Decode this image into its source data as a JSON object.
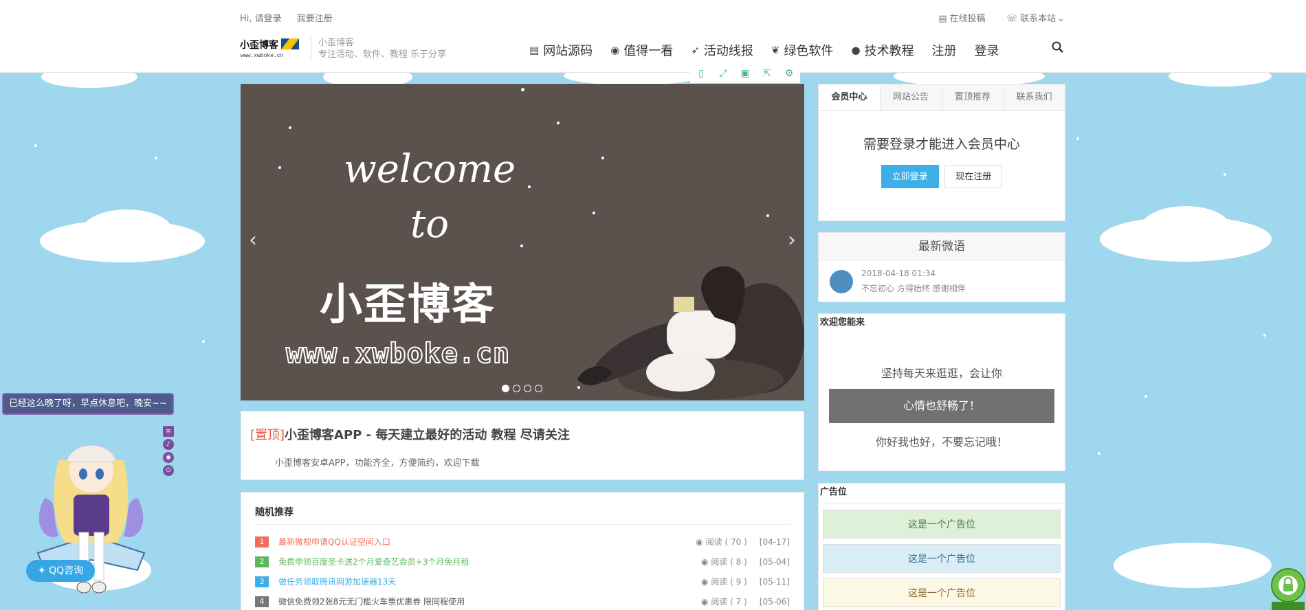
{
  "topbar": {
    "greeting": "Hi, 请登录",
    "register_link": "我要注册",
    "submit_link": "在线投稿",
    "contact_link": "联系本站",
    "logo_alt": "小歪博客",
    "site_name": "小歪博客",
    "site_tagline": "专注活动、软件、教程 乐于分享"
  },
  "nav": {
    "items": [
      {
        "icon": "list-icon",
        "label": "网站源码"
      },
      {
        "icon": "eye-icon",
        "label": "值得一看"
      },
      {
        "icon": "rocket-icon",
        "label": "活动线报"
      },
      {
        "icon": "leaf-icon",
        "label": "绿色软件"
      },
      {
        "icon": "chat-icon",
        "label": "技术教程"
      },
      {
        "icon": "",
        "label": "注册"
      },
      {
        "icon": "",
        "label": "登录"
      }
    ],
    "search_icon": "search-icon"
  },
  "slider": {
    "welcome_line1": "welcome",
    "welcome_line2": "to",
    "title": "小歪博客",
    "url": "www.xwboke.cn",
    "slide_count": 4,
    "active_slide": 1
  },
  "pinned": {
    "tag": "[置顶]",
    "title": "小歪博客APP - 每天建立最好的活动 教程 尽请关注",
    "desc": "小歪博客安卓APP，功能齐全，方便简约，欢迎下载"
  },
  "random": {
    "heading": "随机推荐",
    "rows": [
      {
        "num": "1",
        "title": "最新微视申请QQ认证空间入口",
        "reads": "阅读 ( 70 )",
        "date": "[04-17]",
        "color": "#f26b5b"
      },
      {
        "num": "2",
        "title": "免费申领百度圣卡送2个月爱奇艺会员+3个月免月租",
        "reads": "阅读 ( 8 )",
        "date": "[05-04]",
        "color": "#5cb85c"
      },
      {
        "num": "3",
        "title": "做任务领取腾讯网游加速器13天",
        "reads": "阅读 ( 9 )",
        "date": "[05-11]",
        "color": "#3eaee7"
      },
      {
        "num": "4",
        "title": "微信免费领2张8元无门槛火车票优惠券 限同程使用",
        "reads": "阅读 ( 7 )",
        "date": "[05-06]",
        "color": "#777777"
      }
    ]
  },
  "member": {
    "tabs": [
      "会员中心",
      "网站公告",
      "置顶推荐",
      "联系我们"
    ],
    "message": "需要登录才能进入会员中心",
    "login_btn": "立即登录",
    "register_btn": "现在注册"
  },
  "weibo": {
    "heading": "最新微语",
    "time": "2018-04-18 01:34",
    "text": "不忘初心 方得始终 感谢相伴"
  },
  "welcome_box": {
    "heading": "欢迎您能来",
    "line1": "坚持每天来逛逛，会让你",
    "highlight": "心情也舒畅了！",
    "line2": "你好我也好，不要忘记哦！"
  },
  "ads": {
    "heading": "广告位",
    "items": [
      {
        "label": "这是一个广告位",
        "bg": "#dff0d8",
        "fg": "#3c763d"
      },
      {
        "label": "这是一个广告位",
        "bg": "#d9edf7",
        "fg": "#31708f"
      },
      {
        "label": "这是一个广告位",
        "bg": "#fcf8e3",
        "fg": "#8a6d3b"
      }
    ]
  },
  "mascot": {
    "bubble": "已经这么晚了呀，早点休息吧，晚安~~",
    "qq_button": "QQ咨询"
  },
  "tools": [
    "phone-icon",
    "fullscreen-icon",
    "save-icon",
    "share-icon",
    "gear-icon"
  ]
}
